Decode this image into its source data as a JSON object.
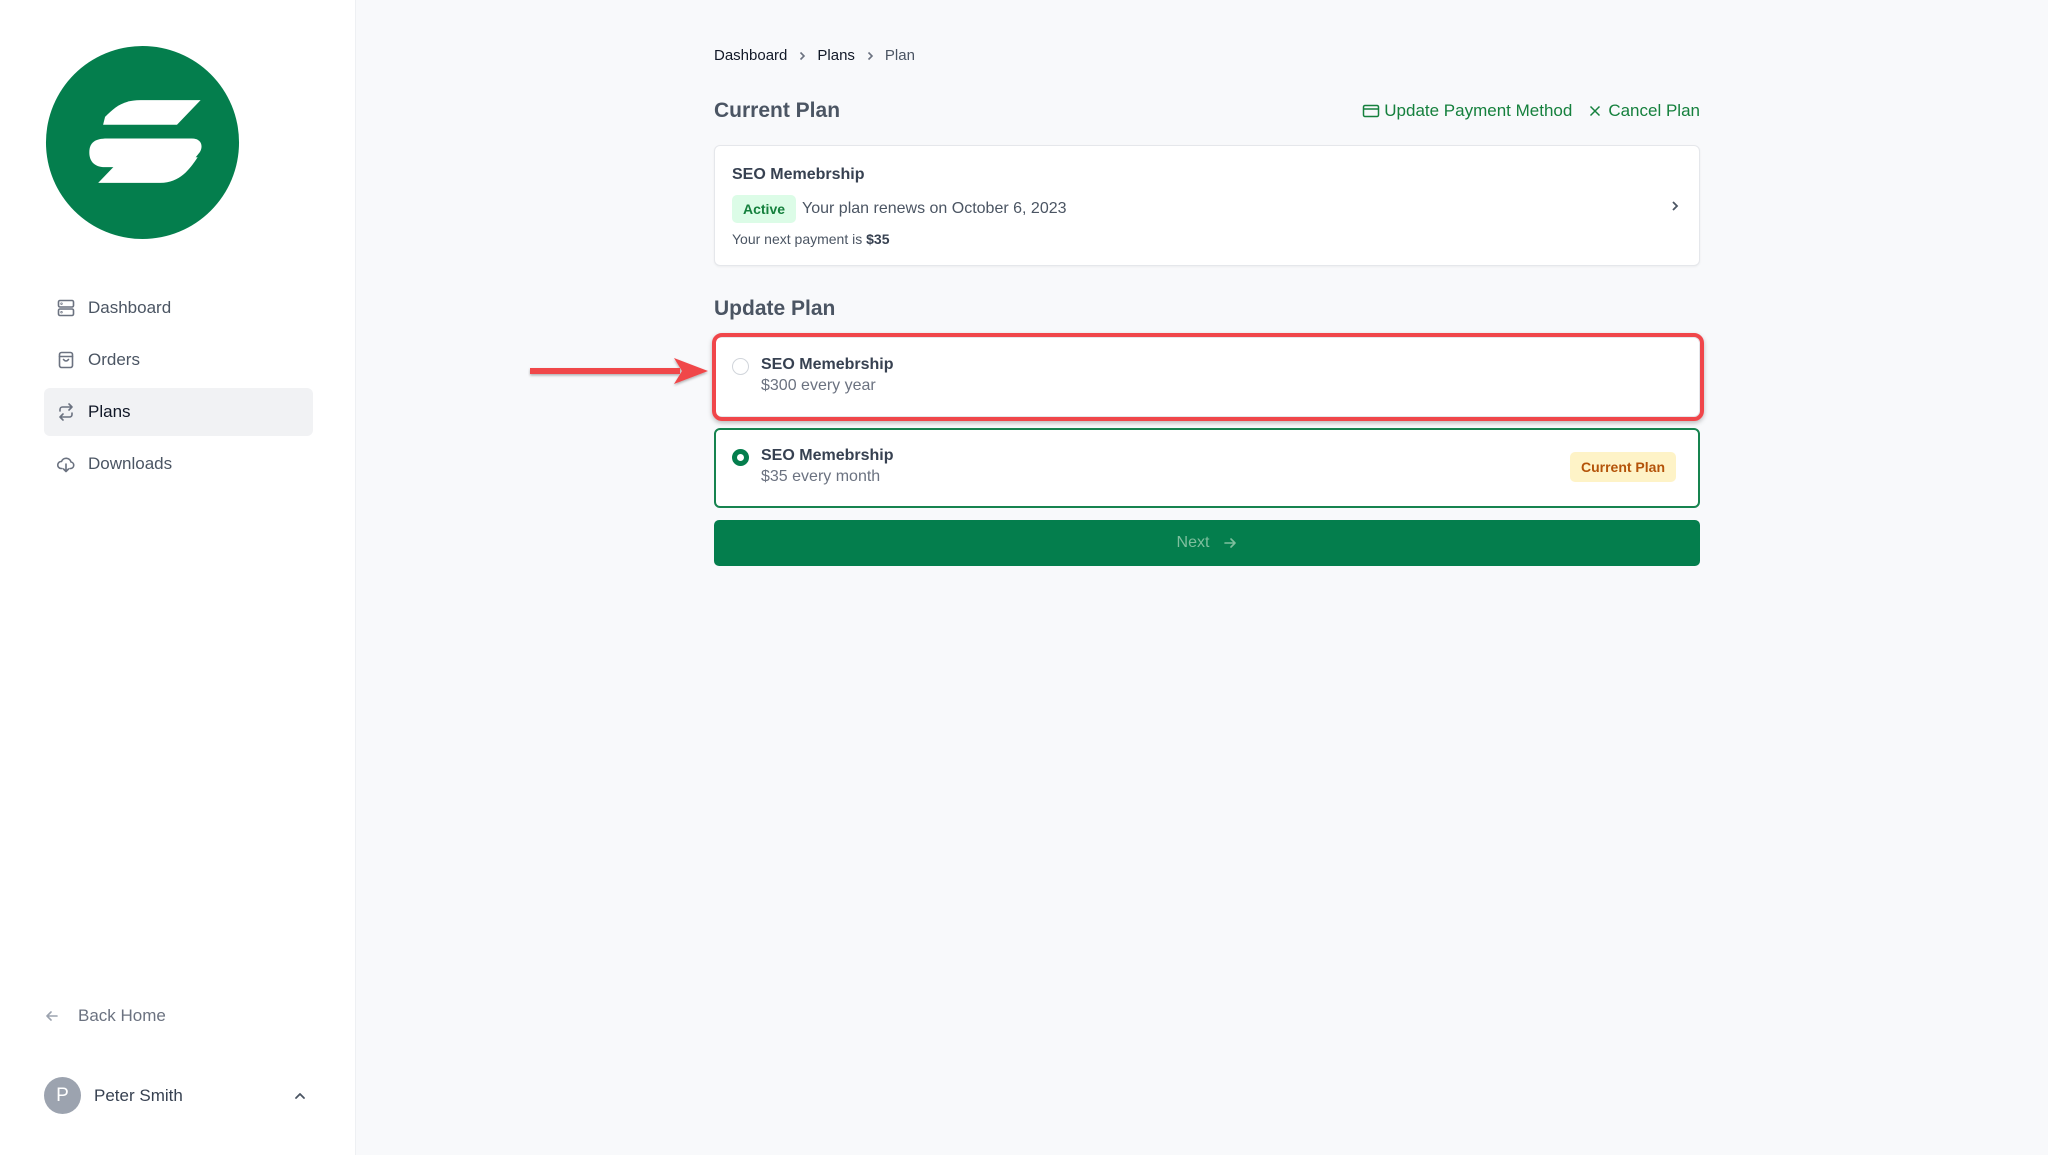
{
  "brand": {
    "logo_icon": "stacked-s-logo-icon",
    "color": "#047e4d"
  },
  "sidebar": {
    "items": [
      {
        "label": "Dashboard",
        "icon": "server-stack-icon",
        "active": false
      },
      {
        "label": "Orders",
        "icon": "shopping-bag-icon",
        "active": false
      },
      {
        "label": "Plans",
        "icon": "arrows-repeat-icon",
        "active": true
      },
      {
        "label": "Downloads",
        "icon": "cloud-download-icon",
        "active": false
      }
    ],
    "back_home": {
      "label": "Back Home",
      "icon": "arrow-left-icon"
    },
    "user": {
      "initial": "P",
      "name": "Peter Smith",
      "icon": "chevron-up-icon"
    }
  },
  "breadcrumb": {
    "items": [
      {
        "label": "Dashboard",
        "current": false
      },
      {
        "label": "Plans",
        "current": false
      },
      {
        "label": "Plan",
        "current": true
      }
    ]
  },
  "current_plan": {
    "title": "Current Plan",
    "actions": {
      "update_payment": {
        "label": "Update Payment Method",
        "icon": "credit-card-icon"
      },
      "cancel": {
        "label": "Cancel Plan",
        "icon": "x-icon"
      }
    },
    "card": {
      "name": "SEO Memebrship",
      "status": "Active",
      "renew_text": "Your plan renews on October 6, 2023",
      "next_payment_prefix": "Your next payment is",
      "next_payment_amount": "$35"
    }
  },
  "update_plan": {
    "title": "Update Plan",
    "options": [
      {
        "name": "SEO Memebrship",
        "price": "$300 every year",
        "selected": false,
        "badge": null
      },
      {
        "name": "SEO Memebrship",
        "price": "$35 every month",
        "selected": true,
        "badge": "Current Plan"
      }
    ],
    "next_button": {
      "label": "Next",
      "icon": "arrow-right-icon",
      "disabled": true
    }
  },
  "annotation": {
    "type": "red-arrow-and-box",
    "target": "option-0",
    "color": "#f0464a"
  },
  "colors": {
    "accent": "#047e4d",
    "link": "#15803d",
    "active_badge_bg": "#dcfce7",
    "current_badge_bg": "#fef3c7",
    "current_badge_text": "#b45309",
    "annotation_red": "#f0464a"
  }
}
